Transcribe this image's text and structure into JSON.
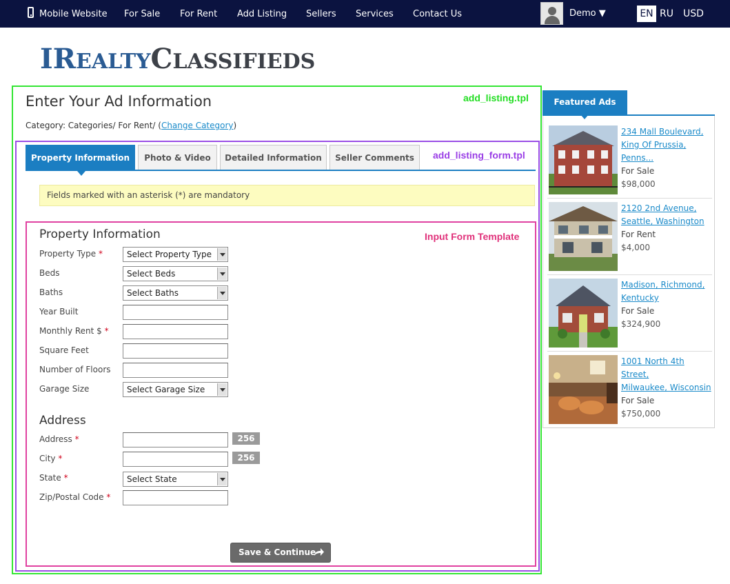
{
  "nav": {
    "mobile": "Mobile Website",
    "for_sale": "For Sale",
    "for_rent": "For Rent",
    "add_listing": "Add Listing",
    "sellers": "Sellers",
    "services": "Services",
    "contact": "Contact Us",
    "user": "Demo ▼",
    "lang_en": "EN",
    "lang_ru": "RU",
    "currency": "USD"
  },
  "logo": {
    "part1_big": "I",
    "part1_rest_big": "R",
    "part1_rest": "EALTY",
    "part2_big": "C",
    "part2_rest": "LASSIFIEDS"
  },
  "page": {
    "title": "Enter Your Ad Information",
    "category_prefix": "Category: Categories/ For Rent/ (",
    "change_category": "Change Category",
    "category_suffix": ")"
  },
  "annotations": {
    "green": "add_listing.tpl",
    "purple": "add_listing_form.tpl",
    "pink": "Input Form Template"
  },
  "tabs": [
    {
      "label": "Property Information",
      "active": true
    },
    {
      "label": "Photo & Video"
    },
    {
      "label": "Detailed Information"
    },
    {
      "label": "Seller Comments"
    }
  ],
  "notice": "Fields marked with an asterisk (*) are mandatory",
  "property": {
    "title": "Property Information",
    "fields": [
      {
        "label": "Property Type",
        "required": "*",
        "type": "select",
        "value": "Select Property Type"
      },
      {
        "label": "Beds",
        "type": "select",
        "value": "Select Beds"
      },
      {
        "label": "Baths",
        "type": "select",
        "value": "Select Baths"
      },
      {
        "label": "Year Built",
        "type": "text",
        "value": ""
      },
      {
        "label": "Monthly Rent $",
        "required": "*",
        "type": "text",
        "value": ""
      },
      {
        "label": "Square Feet",
        "type": "text",
        "value": ""
      },
      {
        "label": "Number of Floors",
        "type": "text",
        "value": ""
      },
      {
        "label": "Garage Size",
        "type": "select",
        "value": "Select Garage Size"
      }
    ]
  },
  "address": {
    "title": "Address",
    "fields": [
      {
        "label": "Address",
        "required": "*",
        "type": "text",
        "value": "",
        "counter": "256"
      },
      {
        "label": "City",
        "required": "*",
        "type": "text",
        "value": "",
        "counter": "256"
      },
      {
        "label": "State",
        "required": "*",
        "type": "select",
        "value": "Select State"
      },
      {
        "label": "Zip/Postal Code",
        "required": "*",
        "type": "text",
        "value": ""
      }
    ]
  },
  "save_button": "Save & Continue",
  "featured": {
    "title": "Featured Ads",
    "ads": [
      {
        "line1": "234 Mall Boulevard,",
        "line2": "King Of Prussia,",
        "line3": "Penns...",
        "status": "For Sale",
        "price": "$98,000"
      },
      {
        "line1": "2120 2nd Avenue,",
        "line2": "Seattle, Washington",
        "line3": "",
        "status": "For Rent",
        "price": "$4,000"
      },
      {
        "line1": "Madison, Richmond,",
        "line2": "Kentucky",
        "line3": "",
        "status": "For Sale",
        "price": "$324,900"
      },
      {
        "line1": "1001 North 4th Street,",
        "line2": "Milwaukee, Wisconsin",
        "line3": "",
        "status": "For Sale",
        "price": "$750,000"
      }
    ]
  },
  "colors": {
    "nav_bg": "#0b1340",
    "accent": "#1b7ec2",
    "green_outline": "#33e633",
    "purple_outline": "#9a4ee6",
    "pink_outline": "#e040a0"
  }
}
